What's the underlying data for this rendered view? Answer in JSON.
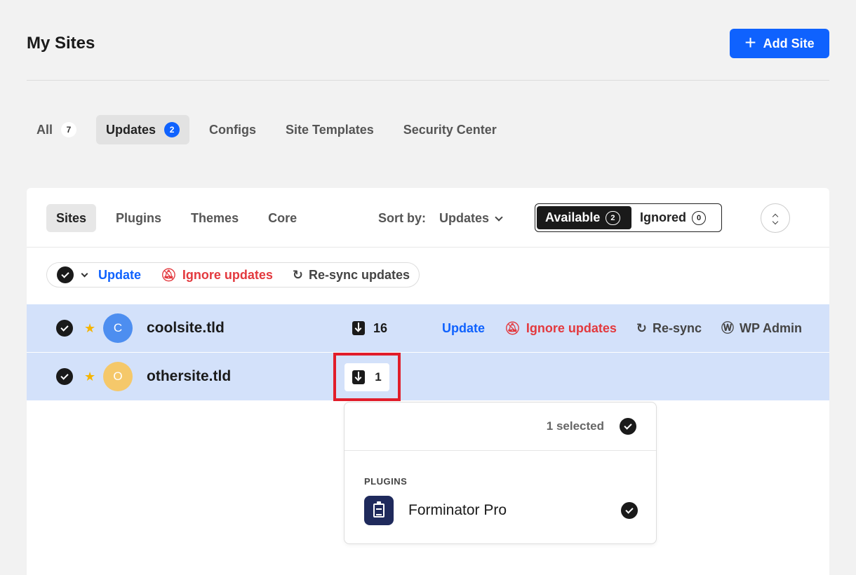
{
  "header": {
    "title": "My Sites",
    "add_site_label": "Add Site"
  },
  "main_tabs": [
    {
      "label": "All",
      "count": "7"
    },
    {
      "label": "Updates",
      "count": "2"
    },
    {
      "label": "Configs"
    },
    {
      "label": "Site Templates"
    },
    {
      "label": "Security Center"
    }
  ],
  "sub_tabs": [
    "Sites",
    "Plugins",
    "Themes",
    "Core"
  ],
  "sort": {
    "label": "Sort by:",
    "value": "Updates"
  },
  "filter_toggle": {
    "available_label": "Available",
    "available_count": "2",
    "ignored_label": "Ignored",
    "ignored_count": "0"
  },
  "bulk_actions": {
    "update": "Update",
    "ignore": "Ignore updates",
    "resync": "Re-sync updates"
  },
  "sites": [
    {
      "initial": "C",
      "name": "coolsite.tld",
      "update_count": "16",
      "avatar_color": "#4d8ef0"
    },
    {
      "initial": "O",
      "name": "othersite.tld",
      "update_count": "1",
      "avatar_color": "#f5c86a"
    }
  ],
  "row_actions": {
    "update": "Update",
    "ignore": "Ignore updates",
    "resync": "Re-sync",
    "wp_admin": "WP Admin"
  },
  "popover": {
    "selected_text": "1 selected",
    "section_label": "PLUGINS",
    "plugin_name": "Forminator Pro"
  },
  "colors": {
    "accent": "#0f62fe",
    "danger": "#e3393e",
    "row_selected": "#d3e1fa",
    "highlight": "#e11d2a"
  }
}
